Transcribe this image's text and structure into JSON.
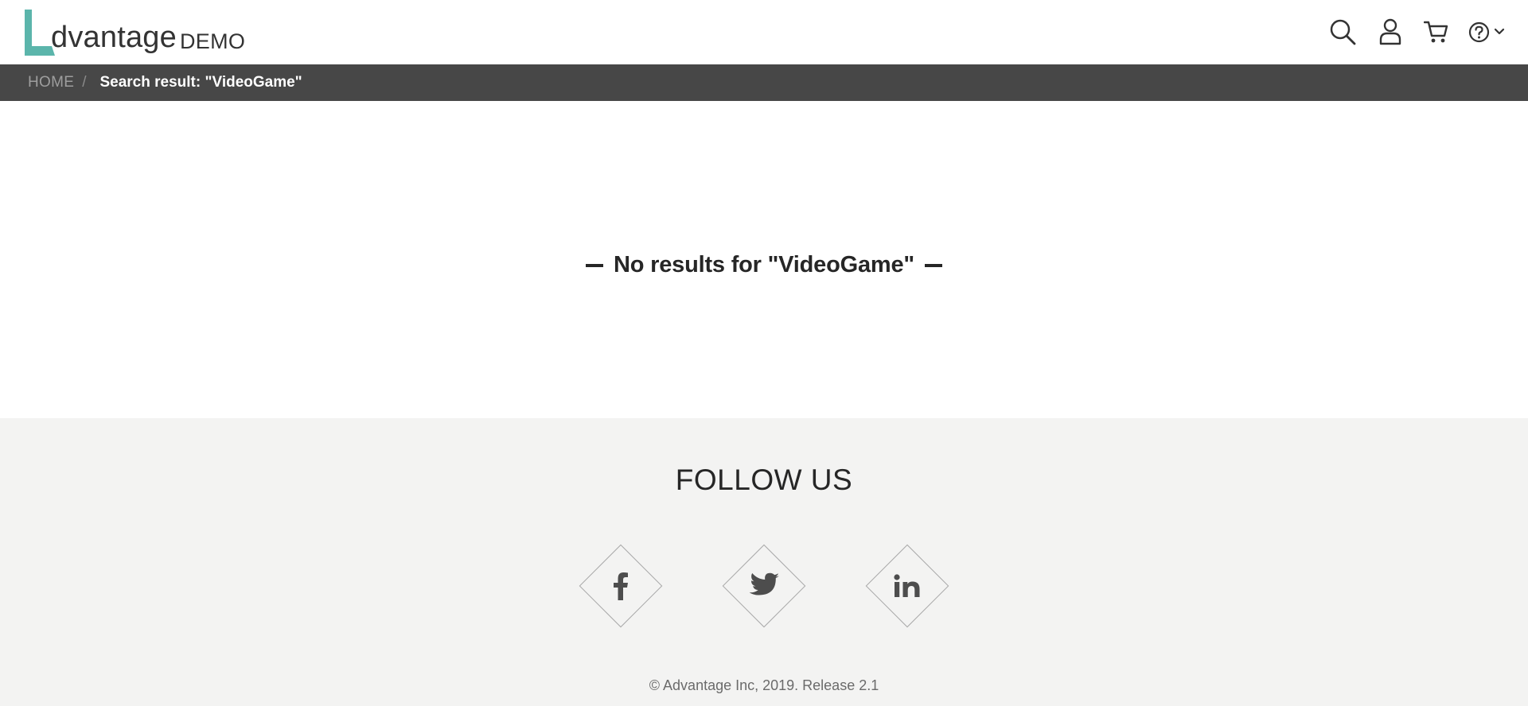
{
  "logo": {
    "word": "dvantage",
    "suffix": "DEMO",
    "accent_color": "#5bb5ab"
  },
  "header": {
    "icons": [
      "search-icon",
      "user-icon",
      "cart-icon",
      "help-icon",
      "chevron-down-icon"
    ]
  },
  "breadcrumb": {
    "home_label": "HOME",
    "separator": "/",
    "current_label": "Search result: \"VideoGame\""
  },
  "main": {
    "no_results_text": "No results for \"VideoGame\""
  },
  "footer": {
    "follow_title": "FOLLOW US",
    "socials": [
      {
        "name": "facebook",
        "glyph": "f"
      },
      {
        "name": "twitter",
        "glyph": "twitter-bird"
      },
      {
        "name": "linkedin",
        "glyph": "in"
      }
    ],
    "copyright": "© Advantage Inc, 2019. Release 2.1"
  },
  "colors": {
    "breadcrumb_bg": "#474747",
    "footer_bg": "#f3f3f2",
    "icon_color": "#333333",
    "social_glyph": "#4d4d4d"
  }
}
